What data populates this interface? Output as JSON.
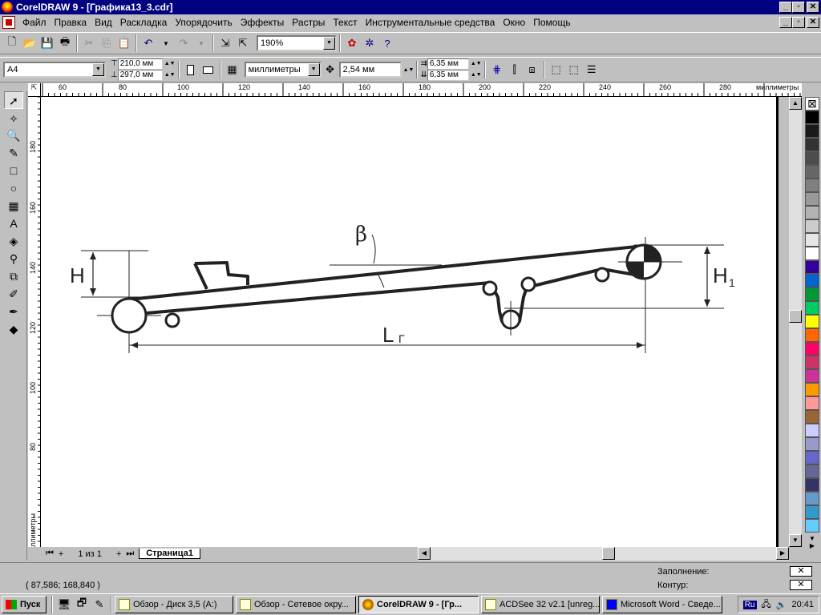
{
  "window": {
    "title": "CorelDRAW 9 - [Графика13_3.cdr]",
    "buttons": [
      "_",
      "▫",
      "✕"
    ]
  },
  "menu": [
    "Файл",
    "Правка",
    "Вид",
    "Раскладка",
    "Упорядочить",
    "Эффекты",
    "Растры",
    "Текст",
    "Инструментальные средства",
    "Окно",
    "Помощь"
  ],
  "standard_toolbar": {
    "zoom": "190%",
    "icons": [
      "new-icon",
      "open-icon",
      "save-icon",
      "print-icon",
      "cut-icon",
      "copy-icon",
      "paste-icon",
      "undo-icon",
      "redo-icon",
      "import-icon",
      "export-icon",
      "zoom-dropdown",
      "corel-icon",
      "help-icon"
    ]
  },
  "property_bar": {
    "paper": "A4",
    "width": "210,0 мм",
    "height": "297,0 мм",
    "units": "миллиметры",
    "nudge": "2,54 мм",
    "dup_x": "6,35 мм",
    "dup_y": "6,35 мм"
  },
  "ruler": {
    "units_label": "миллиметры",
    "h_ticks": [
      "60",
      "80",
      "100",
      "120",
      "140",
      "160",
      "180",
      "200",
      "220",
      "240",
      "260",
      "280"
    ],
    "v_ticks": [
      "180",
      "160",
      "140",
      "120",
      "100",
      "80"
    ],
    "v_units_label": "миллиметры"
  },
  "drawing": {
    "beta_label": "β",
    "h_label": "H",
    "h1_label": "H",
    "h1_sub": "1",
    "l_label": "L",
    "l_sub": "Г"
  },
  "page_tabs": {
    "counter": "1 из 1",
    "active_tab": "Страница1"
  },
  "status": {
    "coords": "( 87,586; 168,840 )",
    "fill_label": "Заполнение:",
    "outline_label": "Контур:"
  },
  "palette": [
    "#ffffff",
    "#000000",
    "#1a1a1a",
    "#333333",
    "#4d4d4d",
    "#666666",
    "#808080",
    "#999999",
    "#b3b3b3",
    "#cccccc",
    "#e6e6e6",
    "#ffffff",
    "#330099",
    "#0066cc",
    "#009933",
    "#00cc66",
    "#ffff00",
    "#ff6600",
    "#ff0066",
    "#cc3366",
    "#cc3399",
    "#ff9900",
    "#ff9999",
    "#996633",
    "#ccccff",
    "#9999cc",
    "#6666cc",
    "#666699",
    "#333366",
    "#6699cc",
    "#3399cc",
    "#66ccff"
  ],
  "taskbar": {
    "start": "Пуск",
    "buttons": [
      "Обзор - Диск 3,5 (A:)",
      "Обзор - Сетевое окру...",
      "CorelDRAW 9 - [Гр...",
      "ACDSee 32 v2.1  [unreg...",
      "Microsoft Word - Сведе..."
    ],
    "lang": "Ru",
    "time": "20:41"
  }
}
